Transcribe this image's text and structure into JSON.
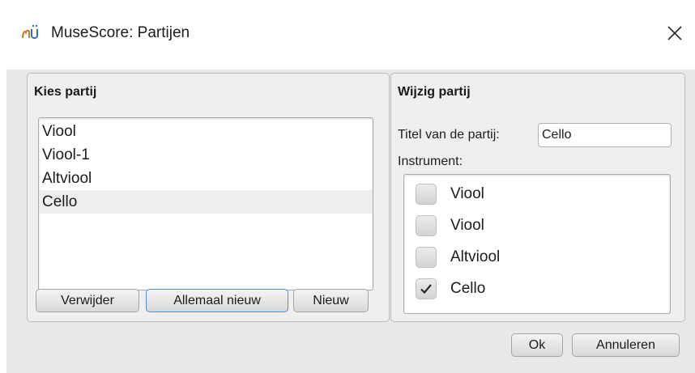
{
  "window": {
    "title": "MuseScore: Partijen",
    "icon": "musescore-logo-icon",
    "close_icon": "close-icon"
  },
  "choose_part": {
    "title": "Kies partij",
    "parts": [
      {
        "label": "Viool",
        "selected": false
      },
      {
        "label": "Viool-1",
        "selected": false
      },
      {
        "label": "Altviool",
        "selected": false
      },
      {
        "label": "Cello",
        "selected": true
      }
    ],
    "buttons": {
      "delete_label": "Verwijder",
      "all_new_label": "Allemaal nieuw",
      "new_label": "Nieuw"
    }
  },
  "edit_part": {
    "title": "Wijzig partij",
    "part_title_label": "Titel van de partij:",
    "part_title_value": "Cello",
    "instrument_label": "Instrument:",
    "instruments": [
      {
        "name": "Viool",
        "checked": false
      },
      {
        "name": "Viool",
        "checked": false
      },
      {
        "name": "Altviool",
        "checked": false
      },
      {
        "name": "Cello",
        "checked": true
      }
    ]
  },
  "footer": {
    "ok_label": "Ok",
    "cancel_label": "Annuleren"
  }
}
